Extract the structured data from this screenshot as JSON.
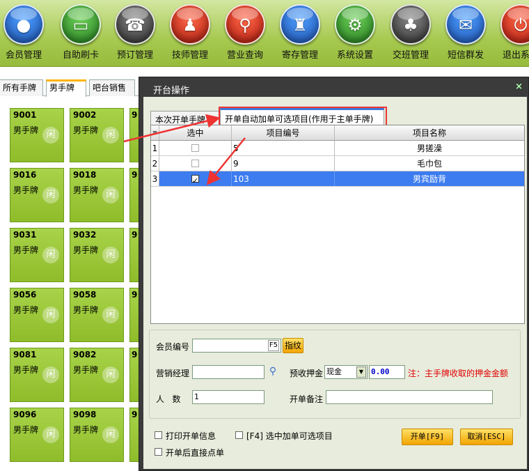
{
  "toolbar": {
    "items": [
      {
        "label": "会员管理",
        "icon": "member-icon",
        "color": "#2a6fd6"
      },
      {
        "label": "自助刷卡",
        "icon": "card-icon",
        "color": "#3a9a30"
      },
      {
        "label": "预订管理",
        "icon": "phone-icon",
        "color": "#555555"
      },
      {
        "label": "技师管理",
        "icon": "technician-icon",
        "color": "#cc2a1a"
      },
      {
        "label": "营业查询",
        "icon": "search-icon",
        "color": "#d82a1a"
      },
      {
        "label": "寄存管理",
        "icon": "bag-icon",
        "color": "#2a6fd6"
      },
      {
        "label": "系统设置",
        "icon": "gear-icon",
        "color": "#3a9a30"
      },
      {
        "label": "交班管理",
        "icon": "shift-icon",
        "color": "#555555"
      },
      {
        "label": "短信群发",
        "icon": "message-icon",
        "color": "#2a6fd6"
      },
      {
        "label": "退出系",
        "icon": "power-icon",
        "color": "#d82a1a"
      }
    ]
  },
  "tabs": [
    {
      "label": "所有手牌"
    },
    {
      "label": "男手牌"
    },
    {
      "label": "吧台销售"
    }
  ],
  "cards": [
    {
      "num": "9001",
      "type": "男手牌"
    },
    {
      "num": "9002",
      "type": "男手牌"
    },
    {
      "num": "9016",
      "type": "男手牌"
    },
    {
      "num": "9018",
      "type": "男手牌"
    },
    {
      "num": "9031",
      "type": "男手牌"
    },
    {
      "num": "9032",
      "type": "男手牌"
    },
    {
      "num": "9056",
      "type": "男手牌"
    },
    {
      "num": "9058",
      "type": "男手牌"
    },
    {
      "num": "9081",
      "type": "男手牌"
    },
    {
      "num": "9082",
      "type": "男手牌"
    },
    {
      "num": "9096",
      "type": "男手牌"
    },
    {
      "num": "9098",
      "type": "男手牌"
    }
  ],
  "card_badge": "闲",
  "card_sliver": "9",
  "dialog": {
    "title": "开台操作",
    "close": "×",
    "tabs": [
      {
        "label": "本次开单手牌"
      },
      {
        "label": "开单自动加单可选项目(作用于主单手牌)"
      }
    ],
    "grid": {
      "headers": [
        "选中",
        "项目编号",
        "项目名称"
      ],
      "row_marker": "≡",
      "rows": [
        {
          "idx": "1",
          "checked": false,
          "code": "5",
          "name": "男搓澡"
        },
        {
          "idx": "2",
          "checked": false,
          "code": "9",
          "name": "毛巾包"
        },
        {
          "idx": "3",
          "checked": true,
          "code": "103",
          "name": "男宾励背"
        }
      ]
    },
    "form": {
      "member_label": "会员编号",
      "member_key": "F5",
      "fingerprint_button": "指纹",
      "manager_label": "营销经理",
      "deposit_label": "预收押金",
      "deposit_type": "现金",
      "deposit_value": "0.00",
      "deposit_note": "注：主手牌收取的押金金额",
      "people_label": "人   数",
      "people_value": "1",
      "remark_label": "开单备注"
    },
    "options": {
      "print_info": "打印开单信息",
      "select_items": "[F4] 选中加单可选项目",
      "direct_order": "开单后直接点单"
    },
    "buttons": {
      "open": "开单[F9]",
      "cancel": "取消[ESC]"
    }
  }
}
